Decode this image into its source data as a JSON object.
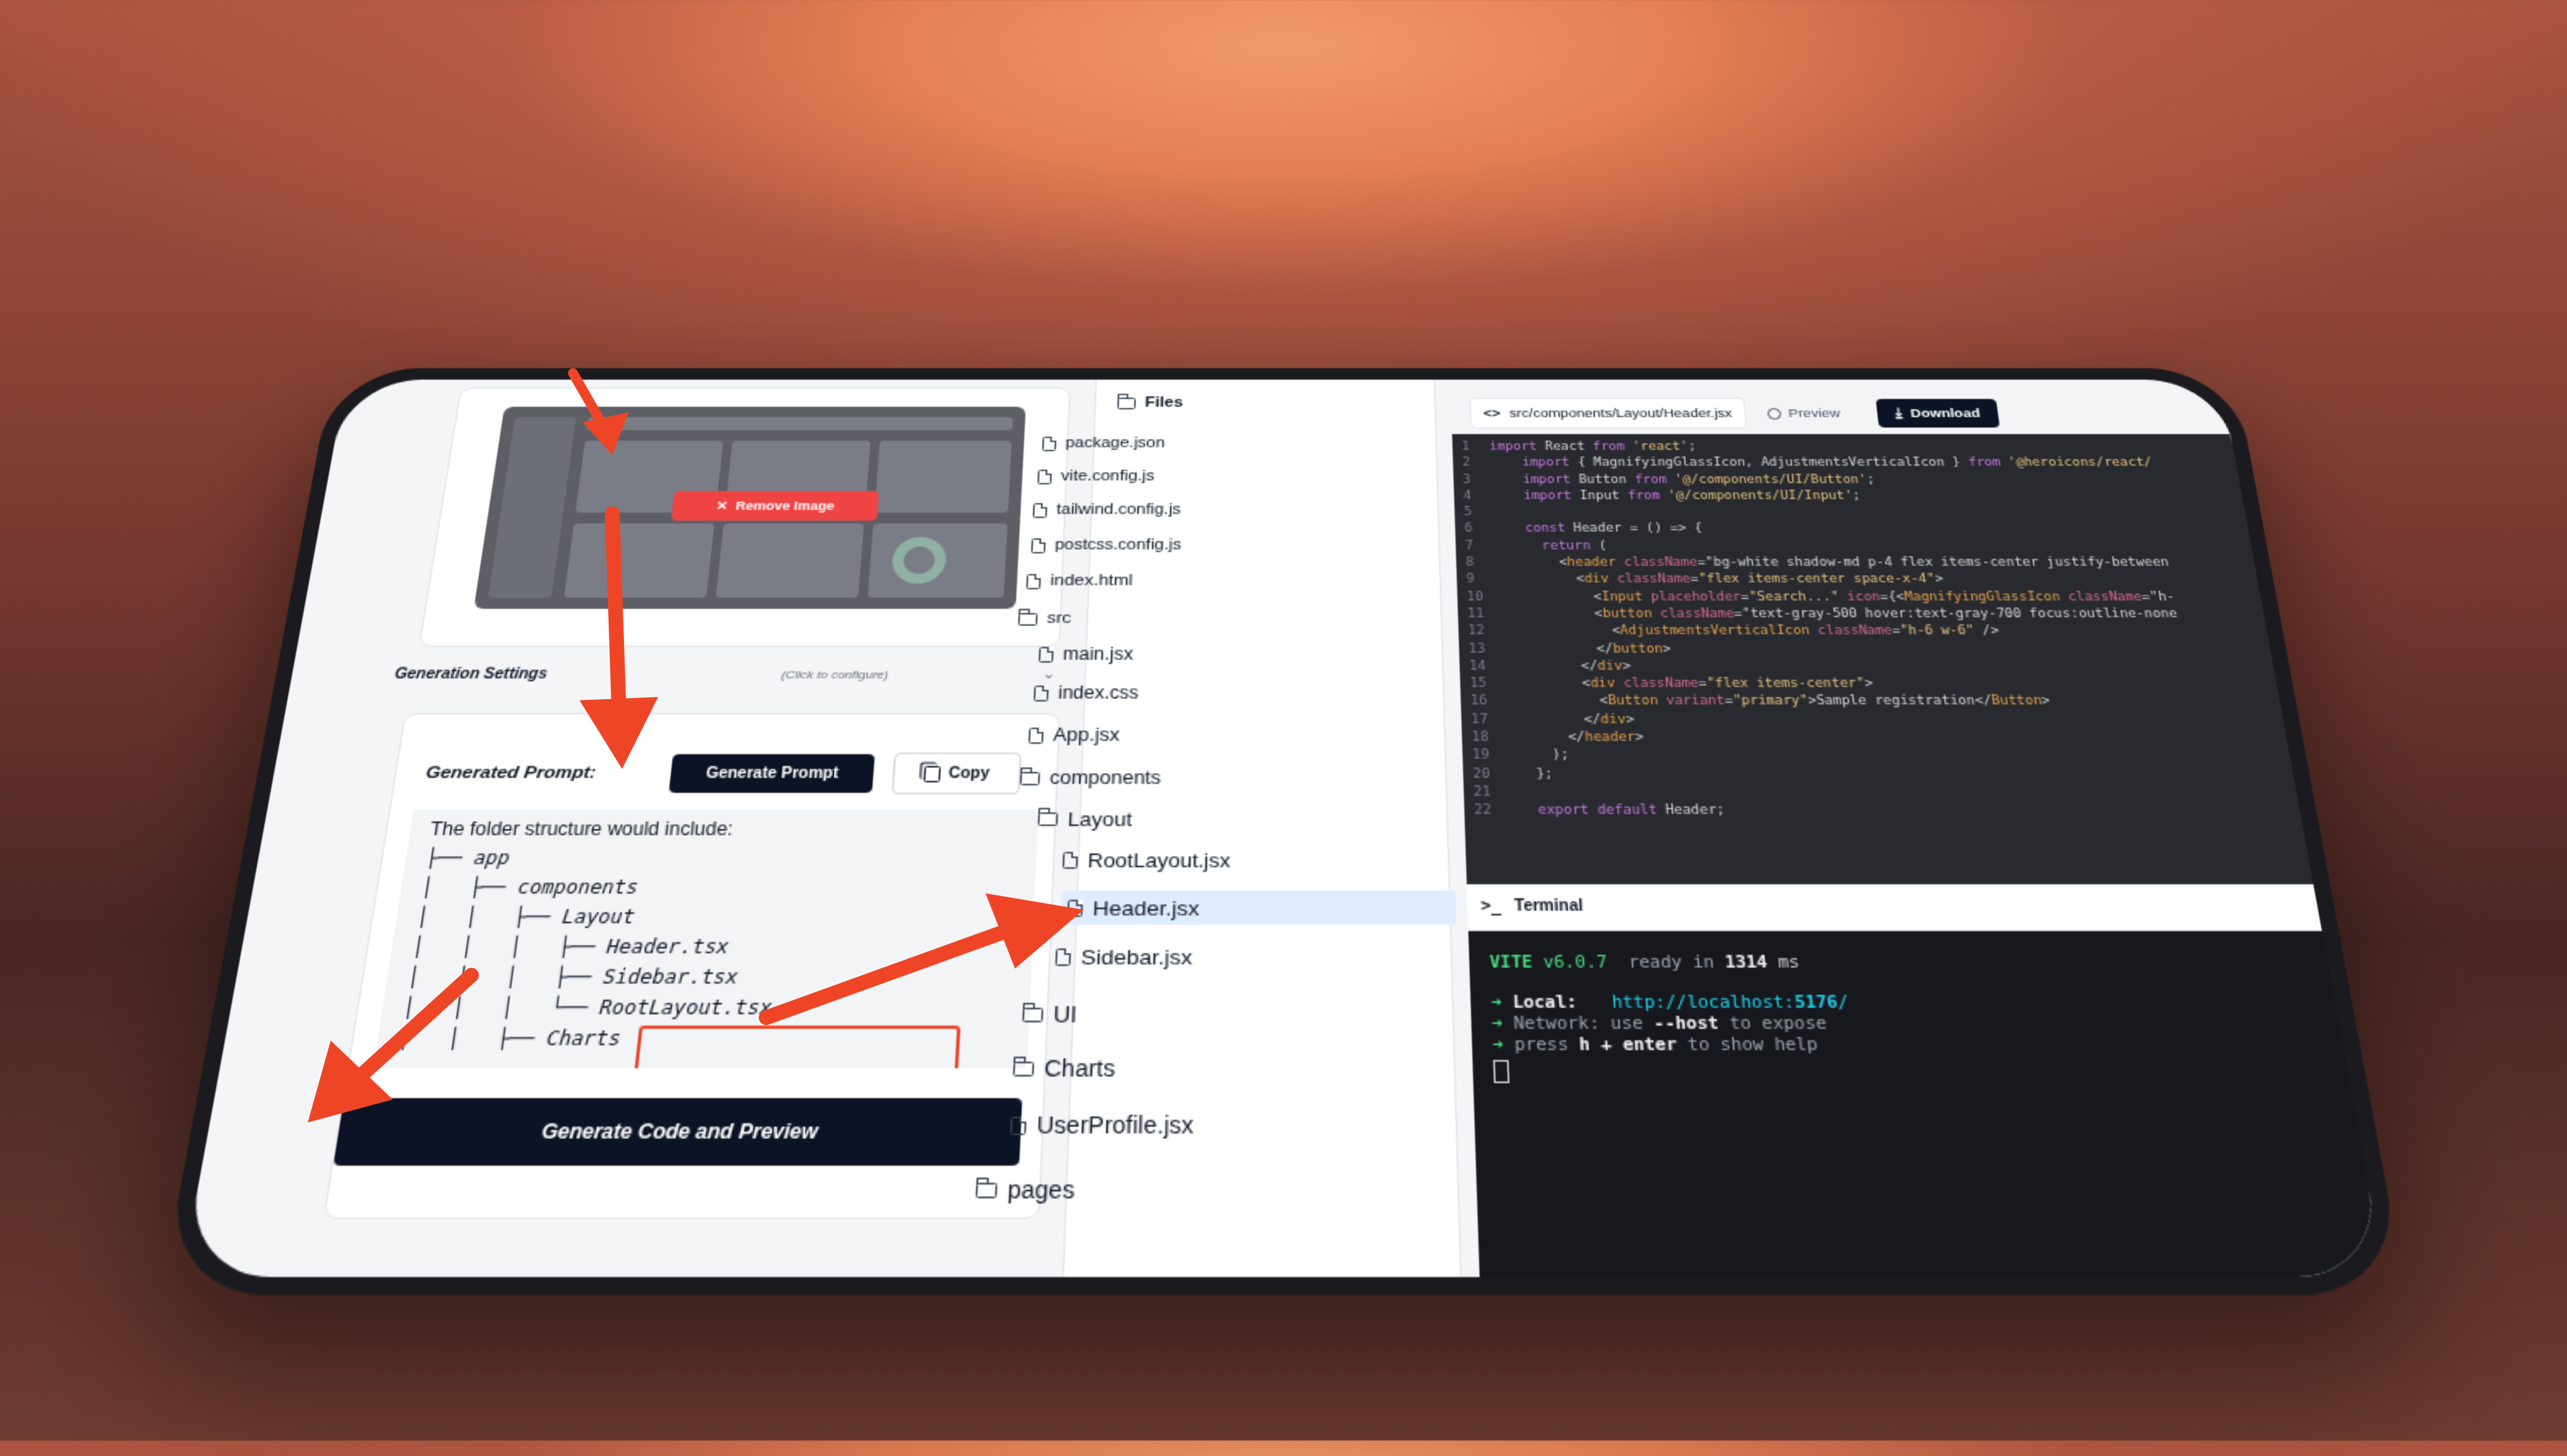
{
  "left_panel": {
    "remove_image_label": "Remove Image",
    "generation_settings_label": "Generation Settings",
    "generation_settings_hint": "(Click to configure)",
    "generated_prompt_label": "Generated Prompt:",
    "generate_prompt_button": "Generate Prompt",
    "copy_button": "Copy",
    "folder_structure_lines": [
      "The folder structure would include:",
      "├── app",
      "│   ├── components",
      "│   │   ├── Layout",
      "│   │   │   ├── Header.tsx",
      "│   │   │   ├── Sidebar.tsx",
      "│   │   │   └── RootLayout.tsx",
      "│   │   ├── Charts"
    ],
    "generate_code_button": "Generate Code and Preview"
  },
  "files_panel": {
    "title": "Files",
    "items": [
      {
        "label": "package.json",
        "type": "file"
      },
      {
        "label": "vite.config.js",
        "type": "file"
      },
      {
        "label": "tailwind.config.js",
        "type": "file"
      },
      {
        "label": "postcss.config.js",
        "type": "file"
      },
      {
        "label": "index.html",
        "type": "file"
      },
      {
        "label": "src",
        "type": "folder"
      },
      {
        "label": "main.jsx",
        "type": "file"
      },
      {
        "label": "index.css",
        "type": "file"
      },
      {
        "label": "App.jsx",
        "type": "file"
      },
      {
        "label": "components",
        "type": "folder"
      },
      {
        "label": "Layout",
        "type": "folder"
      },
      {
        "label": "RootLayout.jsx",
        "type": "file"
      },
      {
        "label": "Header.jsx",
        "type": "file",
        "selected": true
      },
      {
        "label": "Sidebar.jsx",
        "type": "file"
      },
      {
        "label": "UI",
        "type": "folder"
      },
      {
        "label": "Charts",
        "type": "folder"
      },
      {
        "label": "UserProfile.jsx",
        "type": "file"
      },
      {
        "label": "pages",
        "type": "folder"
      }
    ]
  },
  "editor": {
    "tab_path": "src/components/Layout/Header.jsx",
    "preview_tab": "Preview",
    "download_button": "Download",
    "code_lines": [
      "import React from 'react';",
      "    import { MagnifyingGlassIcon, AdjustmentsVerticalIcon } from '@heroicons/react/",
      "    import Button from '@/components/UI/Button';",
      "    import Input from '@/components/UI/Input';",
      "",
      "    const Header = () => {",
      "      return (",
      "        <header className=\"bg-white shadow-md p-4 flex items-center justify-between",
      "          <div className=\"flex items-center space-x-4\">",
      "            <Input placeholder=\"Search...\" icon={<MagnifyingGlassIcon className=\"h-",
      "            <button className=\"text-gray-500 hover:text-gray-700 focus:outline-none",
      "              <AdjustmentsVerticalIcon className=\"h-6 w-6\" />",
      "            </button>",
      "          </div>",
      "          <div className=\"flex items-center\">",
      "            <Button variant=\"primary\">Sample registration</Button>",
      "          </div>",
      "        </header>",
      "      );",
      "    };",
      "",
      "    export default Header;"
    ]
  },
  "terminal": {
    "title": "Terminal",
    "vite_label": "VITE",
    "vite_version": "v6.0.7",
    "ready_text": "ready in",
    "ready_ms": "1314",
    "ms_label": "ms",
    "local_label": "Local:",
    "local_url_base": "http://localhost:",
    "local_port": "5176",
    "local_url_slash": "/",
    "network_label": "Network:",
    "network_text_pre": "use",
    "network_flag": "--host",
    "network_text_post": "to expose",
    "help_pre": "press",
    "help_key": "h + enter",
    "help_post": "to show help"
  },
  "colors": {
    "arrow": "#ef4527",
    "dark_button": "#0b1324",
    "red_button": "#ef4444",
    "code_bg": "#282a30",
    "terminal_bg": "#16181d",
    "vite_green": "#4ade80",
    "url_cyan": "#22d3ee"
  }
}
